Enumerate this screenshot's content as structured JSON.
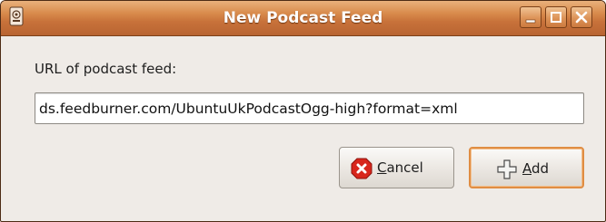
{
  "window": {
    "title": "New Podcast Feed",
    "accent_color": "#c8723a",
    "focus_color": "#e08d43"
  },
  "titlebar": {
    "app_icon": "document-icon",
    "controls": {
      "minimize_icon": "minimize-icon",
      "maximize_icon": "maximize-icon",
      "close_icon": "close-icon"
    }
  },
  "form": {
    "prompt_label": "URL of podcast feed:",
    "url_value": "ds.feedburner.com/UbuntuUkPodcastOgg-high?format=xml"
  },
  "buttons": {
    "cancel": {
      "mnemonic": "C",
      "rest": "ancel",
      "icon": "cancel-icon"
    },
    "add": {
      "mnemonic": "A",
      "rest": "dd",
      "icon": "add-icon"
    }
  }
}
